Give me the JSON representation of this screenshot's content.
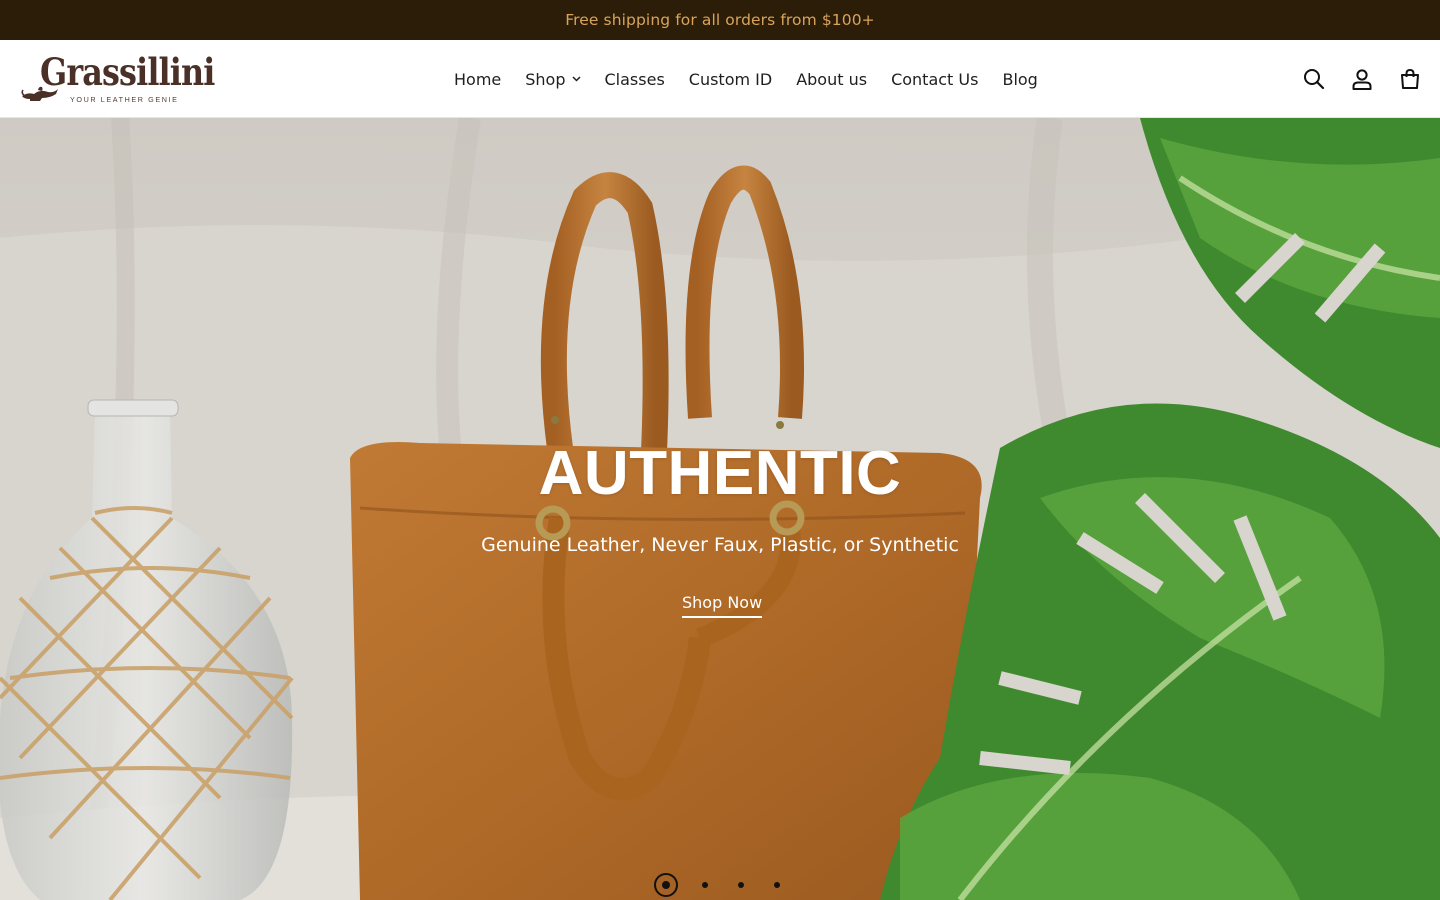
{
  "announcement": {
    "text": "Free shipping for all orders from $100+"
  },
  "brand": {
    "name": "Grassillini",
    "tagline": "YOUR LEATHER GENIE"
  },
  "nav": {
    "items": [
      {
        "label": "Home"
      },
      {
        "label": "Shop",
        "has_dropdown": true
      },
      {
        "label": "Classes"
      },
      {
        "label": "Custom ID"
      },
      {
        "label": "About us"
      },
      {
        "label": "Contact Us"
      },
      {
        "label": "Blog"
      }
    ]
  },
  "header_icons": [
    "search-icon",
    "account-icon",
    "cart-icon"
  ],
  "hero": {
    "title": "AUTHENTIC",
    "subtitle": "Genuine Leather, Never Faux, Plastic, or Synthetic",
    "cta": "Shop Now",
    "slides": 4,
    "active_slide": 1
  },
  "colors": {
    "announcement_bg": "#2b1d08",
    "announcement_text": "#d9a45a",
    "logo": "#4a3027",
    "leather": "#b8722e"
  }
}
